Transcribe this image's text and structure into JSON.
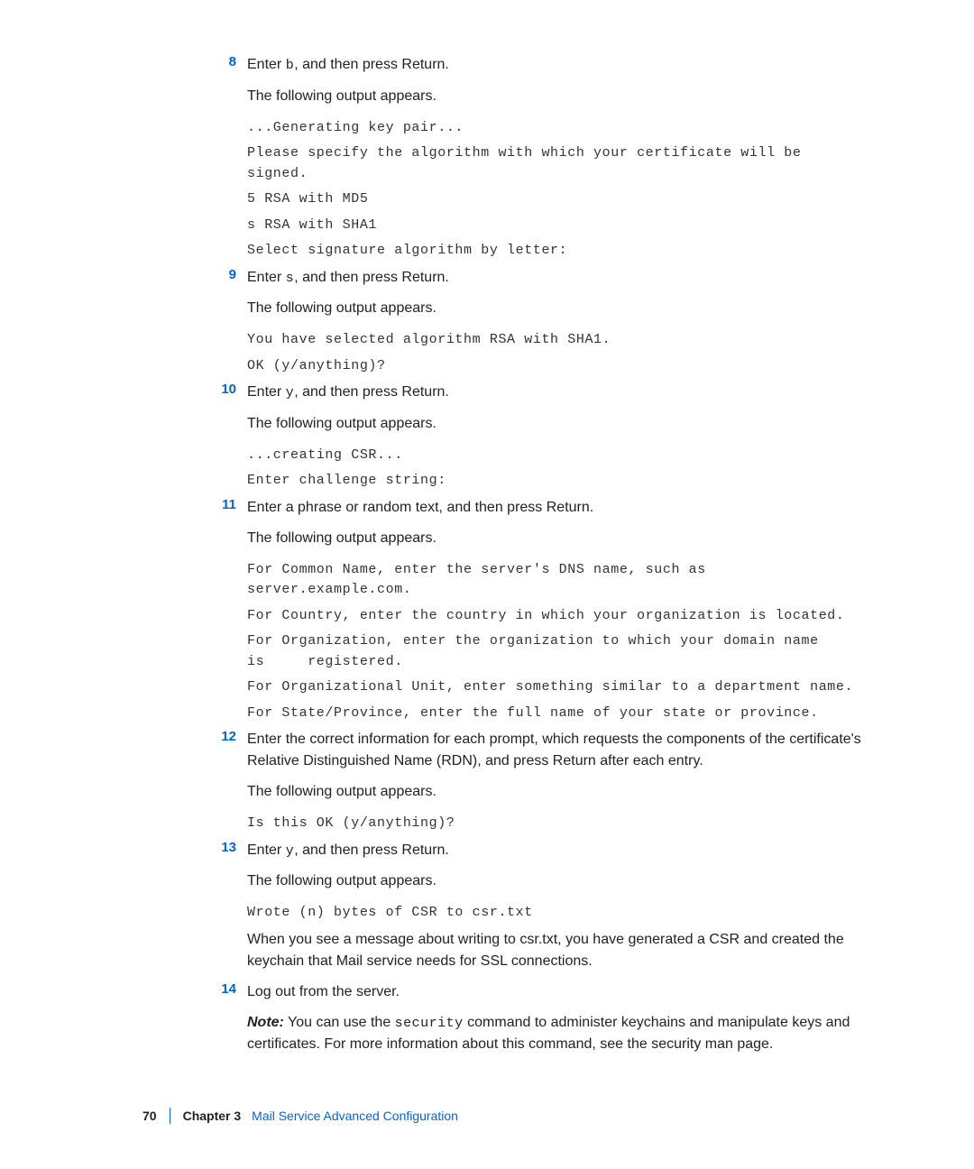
{
  "steps": [
    {
      "num": "8",
      "enter_pre": "Enter ",
      "enter_code": "b",
      "enter_post": ", and then press Return.",
      "following": "The following output appears.",
      "output": [
        "...Generating key pair...",
        "Please specify the algorithm with which your certificate will be signed.",
        " 5 RSA with MD5",
        " s RSA with SHA1",
        "Select signature algorithm by letter:"
      ]
    },
    {
      "num": "9",
      "enter_pre": "Enter ",
      "enter_code": "s",
      "enter_post": ", and then press Return.",
      "following": "The following output appears.",
      "output": [
        "You have selected algorithm RSA with SHA1.",
        "OK (y/anything)?"
      ]
    },
    {
      "num": "10",
      "enter_pre": "Enter ",
      "enter_code": "y",
      "enter_post": ", and then press Return.",
      "following": "The following output appears.",
      "output": [
        "...creating CSR...",
        "Enter challenge string:"
      ]
    },
    {
      "num": "11",
      "instruction": "Enter a phrase or random text, and then press Return.",
      "following": "The following output appears.",
      "output": [
        "For Common Name, enter the server's DNS name, such as server.example.com.",
        "For Country, enter the country in which your organization is located.",
        "For Organization, enter the organization to which your domain name is     registered.",
        "For Organizational Unit, enter something similar to a department name.",
        "For State/Province, enter the full name of your state or province."
      ]
    },
    {
      "num": "12",
      "instruction": "Enter the correct information for each prompt, which requests the components of the certificate's Relative Distinguished Name (RDN), and press Return after each entry.",
      "following": "The following output appears.",
      "output": [
        "Is this OK (y/anything)?"
      ]
    },
    {
      "num": "13",
      "enter_pre": "Enter ",
      "enter_code": "y",
      "enter_post": ", and then press Return.",
      "following": "The following output appears.",
      "output": [
        "Wrote (n) bytes of CSR to csr.txt"
      ],
      "after_text": "When you see a message about writing to csr.txt, you have generated a CSR and created the keychain that Mail service needs for SSL connections."
    },
    {
      "num": "14",
      "instruction": "Log out from the server.",
      "note_label": "Note:",
      "note_pre": "  You can use the ",
      "note_code": "security",
      "note_post": " command to administer keychains and manipulate keys and certificates. For more information about this command, see the security man page."
    }
  ],
  "footer": {
    "page": "70",
    "chapter_label": "Chapter 3",
    "chapter_title": "Mail Service Advanced Configuration"
  }
}
